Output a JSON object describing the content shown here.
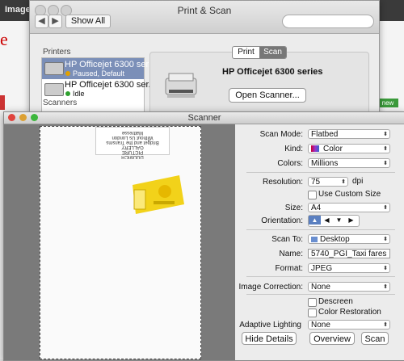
{
  "browser": {
    "tab_label": "Images",
    "logo_fragment": "e",
    "badge": "new"
  },
  "print_scan": {
    "title": "Print & Scan",
    "show_all": "Show All",
    "printers_label": "Printers",
    "scanners_label": "Scanners",
    "printers": [
      {
        "name": "HP Officejet 6300 series",
        "status": "Paused, Default",
        "status_color": "#e0a000"
      },
      {
        "name": "HP Officejet 6300 ser...",
        "status": "Idle",
        "status_color": "#2ea02e"
      }
    ],
    "tabs": [
      "Print",
      "Scan"
    ],
    "model": "HP Officejet 6300 series",
    "open_scanner": "Open Scanner..."
  },
  "scanner": {
    "title": "Scanner",
    "scan_mode_label": "Scan Mode:",
    "scan_mode": "Flatbed",
    "kind_label": "Kind:",
    "kind": "Color",
    "colors_label": "Colors:",
    "colors": "Millions",
    "resolution_label": "Resolution:",
    "resolution": "75",
    "resolution_unit": "dpi",
    "custom_size": "Use Custom Size",
    "size_label": "Size:",
    "size": "A4",
    "orientation_label": "Orientation:",
    "scan_to_label": "Scan To:",
    "scan_to": "Desktop",
    "name_label": "Name:",
    "name": "5740_PGI_Taxi fares",
    "format_label": "Format:",
    "format": "JPEG",
    "image_correction_label": "Image Correction:",
    "image_correction": "None",
    "descreen": "Descreen",
    "color_restoration": "Color Restoration",
    "adaptive_lighting_label": "Adaptive Lighting",
    "adaptive_lighting": "None",
    "hide_details": "Hide Details",
    "overview": "Overview",
    "scan": "Scan"
  },
  "receipt_text": [
    "DULWICH",
    "PICTURE",
    "GALLERY",
    "Bridget and the Transms",
    "Without Us London Mattresse"
  ]
}
